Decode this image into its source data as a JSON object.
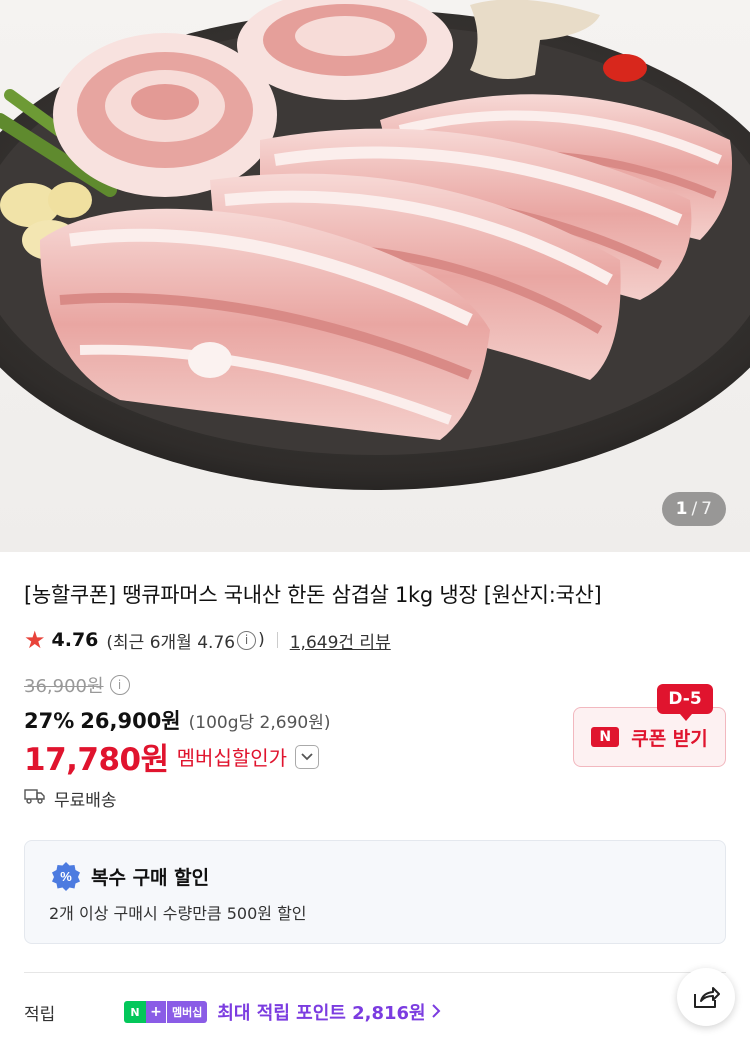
{
  "gallery": {
    "current": "1",
    "separator": "/",
    "total": "7"
  },
  "product": {
    "title": "[농할쿠폰] 땡큐파머스 국내산 한돈 삼겹살 1kg 냉장 [원산지:국산]",
    "rating_score": "4.76",
    "rating_recent_prefix": "(최근 6개월 4.76",
    "rating_recent_suffix": ")",
    "review_count": "1,649건 리뷰",
    "original_price": "36,900원",
    "discount_rate": "27%",
    "sale_price": "26,900원",
    "unit_price": "(100g당 2,690원)",
    "member_price": "17,780원",
    "member_label": "멤버십할인가",
    "shipping": "무료배송"
  },
  "coupon": {
    "dday": "D-5",
    "logo": "N",
    "label": "쿠폰 받기"
  },
  "multi_discount": {
    "title": "복수 구매 할인",
    "description": "2개 이상 구매시 수량만큼 500원 할인",
    "icon": "percent-badge-icon"
  },
  "points": {
    "label": "적립",
    "badge_n": "N",
    "badge_plus": "+",
    "badge_membership": "멤버십",
    "text": "최대 적립 포인트 2,816원"
  },
  "colors": {
    "accent_red": "#e0142e",
    "point_purple": "#7b3ce0",
    "naver_green": "#03c75a"
  }
}
